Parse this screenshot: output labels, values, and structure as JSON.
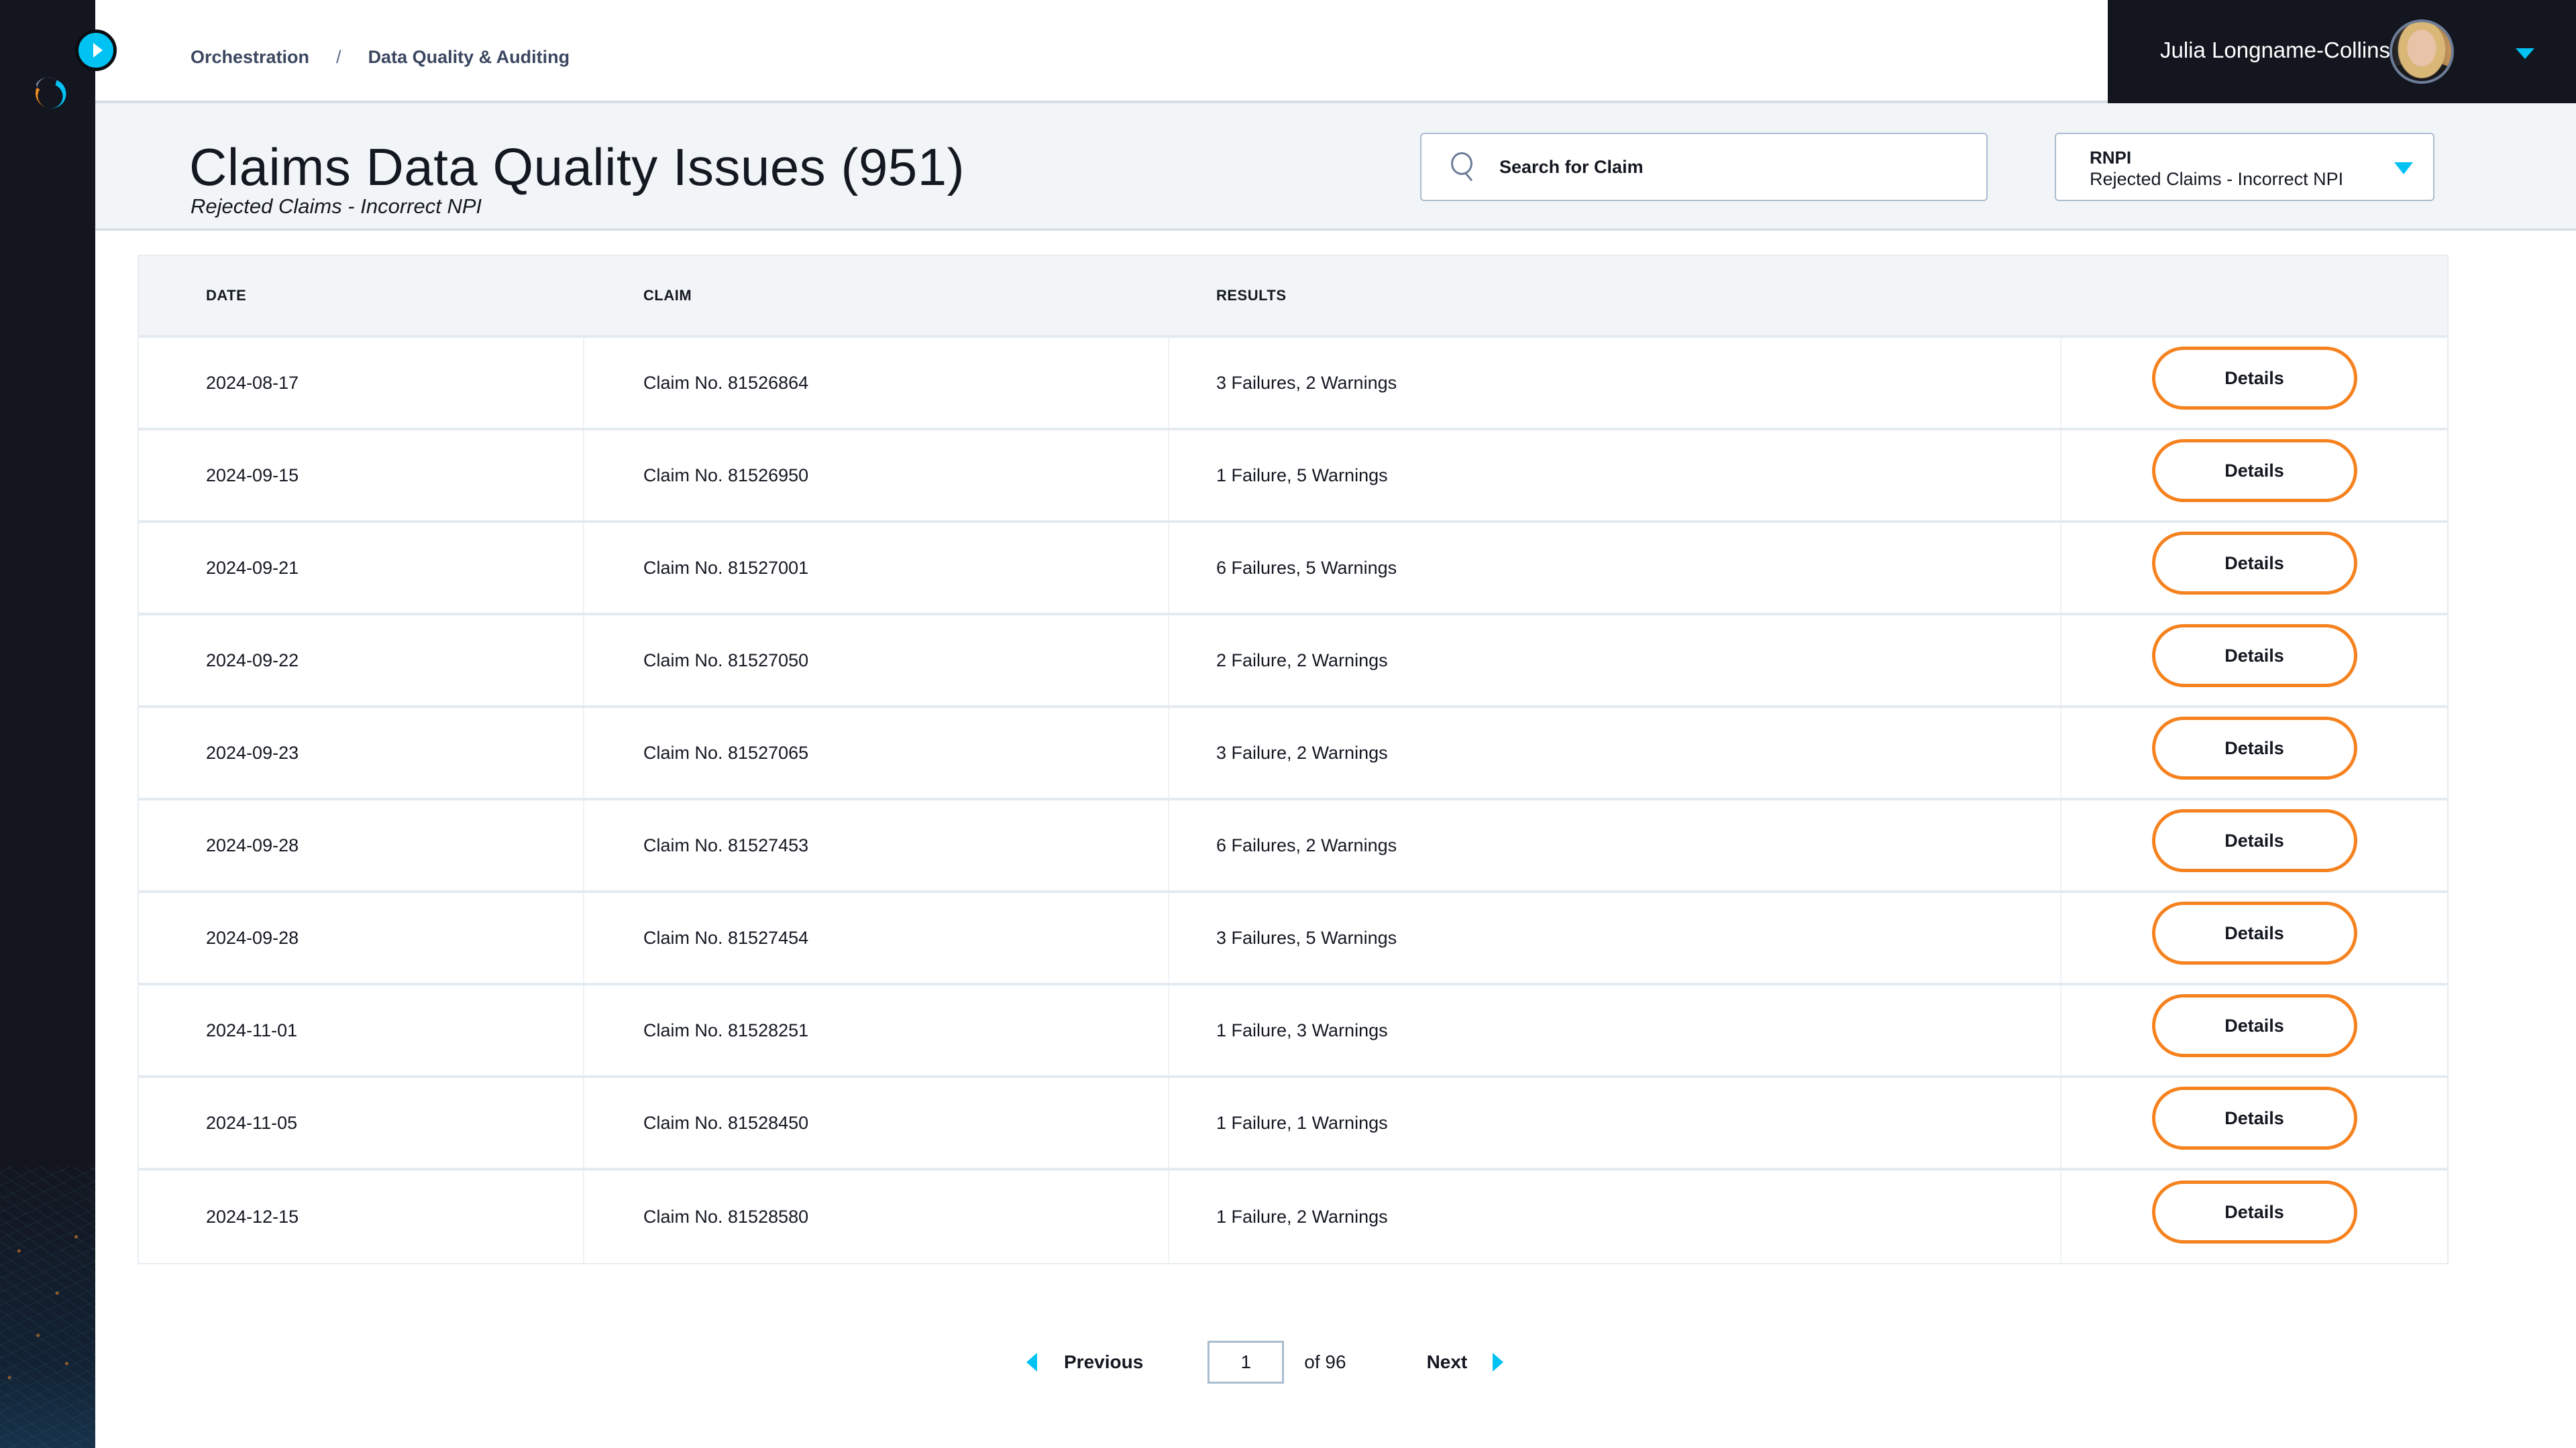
{
  "app": {
    "expand_icon": "chevron-right-icon",
    "logo_icon": "orbit-logo-icon"
  },
  "breadcrumb": {
    "items": [
      "Orchestration",
      "Data Quality & Auditing"
    ],
    "separator": "/"
  },
  "user": {
    "name": "Julia Longname-Collins",
    "menu_icon": "caret-down-icon"
  },
  "header": {
    "title": "Claims Data Quality Issues (951)",
    "subtitle": "Rejected Claims - Incorrect NPI"
  },
  "search": {
    "placeholder": "Search for Claim",
    "value": "",
    "icon": "search-icon"
  },
  "filter": {
    "code": "RNPI",
    "label": "Rejected Claims - Incorrect NPI",
    "icon": "caret-down-icon"
  },
  "table": {
    "columns": [
      "DATE",
      "CLAIM",
      "RESULTS",
      ""
    ],
    "action_label": "Details",
    "rows": [
      {
        "date": "2024-08-17",
        "claim": "Claim No. 81526864",
        "results": "3 Failures, 2 Warnings"
      },
      {
        "date": "2024-09-15",
        "claim": "Claim No. 81526950",
        "results": "1 Failure, 5 Warnings"
      },
      {
        "date": "2024-09-21",
        "claim": "Claim No. 81527001",
        "results": "6 Failures, 5 Warnings"
      },
      {
        "date": "2024-09-22",
        "claim": "Claim No. 81527050",
        "results": "2 Failure, 2 Warnings"
      },
      {
        "date": "2024-09-23",
        "claim": "Claim No. 81527065",
        "results": "3 Failure, 2 Warnings"
      },
      {
        "date": "2024-09-28",
        "claim": "Claim No. 81527453",
        "results": "6 Failures, 2 Warnings"
      },
      {
        "date": "2024-09-28",
        "claim": "Claim No. 81527454",
        "results": "3 Failures, 5 Warnings"
      },
      {
        "date": "2024-11-01",
        "claim": "Claim No. 81528251",
        "results": "1 Failure, 3 Warnings"
      },
      {
        "date": "2024-11-05",
        "claim": "Claim No. 81528450",
        "results": "1 Failure, 1 Warnings"
      },
      {
        "date": "2024-12-15",
        "claim": "Claim No. 81528580",
        "results": "1 Failure, 2 Warnings"
      }
    ]
  },
  "pagination": {
    "previous_label": "Previous",
    "next_label": "Next",
    "current_page": "1",
    "of_label": "of 96"
  },
  "colors": {
    "accent": "#00c2f3",
    "action_border": "#f5821f",
    "rail_bg": "#13161f",
    "band_bg": "#f2f5f8"
  }
}
